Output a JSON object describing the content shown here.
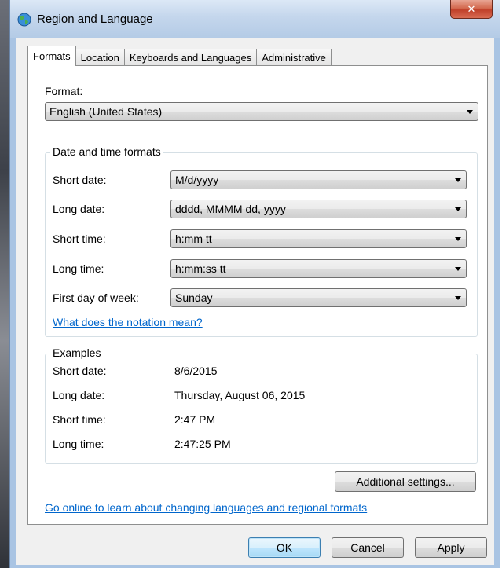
{
  "window": {
    "title": "Region and Language",
    "close_glyph": "✕"
  },
  "tabs": [
    {
      "label": "Formats"
    },
    {
      "label": "Location"
    },
    {
      "label": "Keyboards and Languages"
    },
    {
      "label": "Administrative"
    }
  ],
  "format": {
    "label": "Format:",
    "value": "English (United States)"
  },
  "date_time_formats": {
    "title": "Date and time formats",
    "rows": [
      {
        "label": "Short date:",
        "value": "M/d/yyyy"
      },
      {
        "label": "Long date:",
        "value": "dddd, MMMM dd, yyyy"
      },
      {
        "label": "Short time:",
        "value": "h:mm tt"
      },
      {
        "label": "Long time:",
        "value": "h:mm:ss tt"
      },
      {
        "label": "First day of week:",
        "value": "Sunday"
      }
    ],
    "notation_link": "What does the notation mean?"
  },
  "examples": {
    "title": "Examples",
    "rows": [
      {
        "label": "Short date:",
        "value": "8/6/2015"
      },
      {
        "label": "Long date:",
        "value": "Thursday, August 06, 2015"
      },
      {
        "label": "Short time:",
        "value": "2:47 PM"
      },
      {
        "label": "Long time:",
        "value": "2:47:25 PM"
      }
    ]
  },
  "additional_settings_label": "Additional settings...",
  "online_link": "Go online to learn about changing languages and regional formats",
  "buttons": {
    "ok": "OK",
    "cancel": "Cancel",
    "apply": "Apply"
  }
}
